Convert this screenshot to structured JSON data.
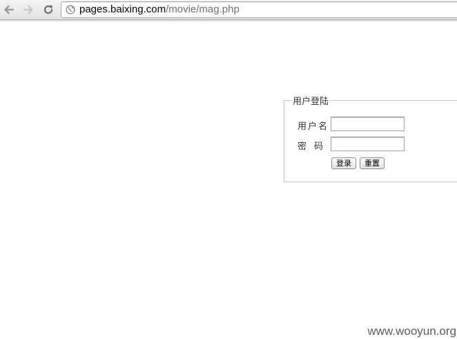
{
  "browser": {
    "url_host": "pages.baixing.com",
    "url_path": "/movie/mag.php",
    "icons": {
      "back": "back-arrow-icon",
      "forward": "forward-arrow-icon",
      "reload": "reload-icon",
      "site": "globe-icon"
    }
  },
  "login_form": {
    "legend": "用户登陆",
    "username_label": "用户名",
    "password_label": "密码",
    "username_value": "",
    "password_value": "",
    "login_button": "登录",
    "reset_button": "重置"
  },
  "watermark": "www.wooyun.org",
  "colors": {
    "fieldset_border": "#c0c0c0",
    "text": "#333333",
    "url_path": "#6f6f6f"
  }
}
